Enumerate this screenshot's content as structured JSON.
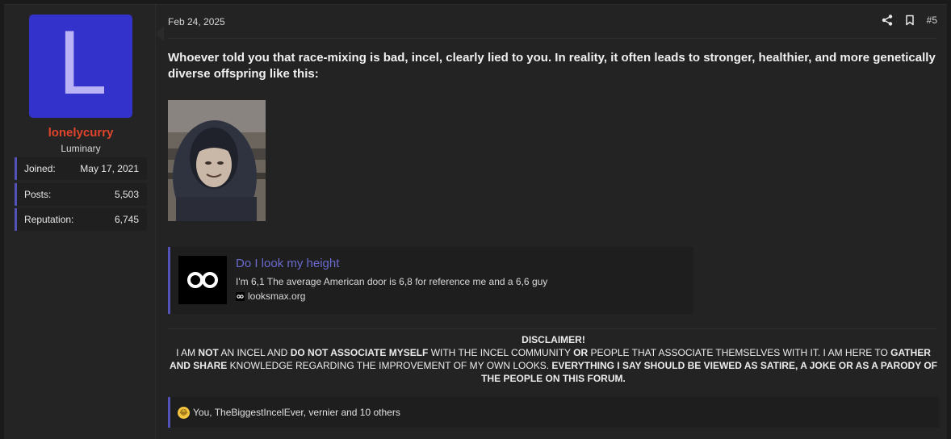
{
  "user": {
    "avatar_letter": "L",
    "avatar_color": "#3333cc",
    "name": "lonelycurry",
    "name_color": "#e0442c",
    "title": "Luminary",
    "stats": [
      {
        "label": "Joined:",
        "value": "May 17, 2021"
      },
      {
        "label": "Posts:",
        "value": "5,503"
      },
      {
        "label": "Reputation:",
        "value": "6,745"
      }
    ]
  },
  "post": {
    "date": "Feb 24, 2025",
    "number": "#5",
    "message": "Whoever told you that race-mixing is bad, incel, clearly lied to you. In reality, it often leads to stronger, healthier, and more genetically diverse offspring like this:",
    "icons": [
      "share-icon",
      "bookmark-icon"
    ]
  },
  "embed": {
    "title": "Do I look my height",
    "description": "I'm 6,1 The average American door is 6,8 for reference me and a 6,6 guy",
    "site": "looksmax.org"
  },
  "signature": {
    "heading": "DISCLAIMER!",
    "p1": "I AM ",
    "b1": "NOT",
    "p2": " AN INCEL AND ",
    "b2": "DO NOT ASSOCIATE MYSELF",
    "p3": " WITH THE INCEL COMMUNITY ",
    "b3": "OR",
    "p4": " PEOPLE THAT ASSOCIATE THEMSELVES WITH IT. I AM HERE TO ",
    "b4": "GATHER AND SHARE",
    "p5": " KNOWLEDGE REGARDING THE IMPROVEMENT OF MY OWN LOOKS. ",
    "b5": "EVERYTHING I SAY SHOULD BE VIEWED AS SATIRE, A JOKE OR AS A PARODY OF THE PEOPLE ON THIS FORUM."
  },
  "reactions": {
    "text": "You, TheBiggestIncelEver, vernier and 10 others",
    "icon": "laughing-emoji-icon"
  }
}
